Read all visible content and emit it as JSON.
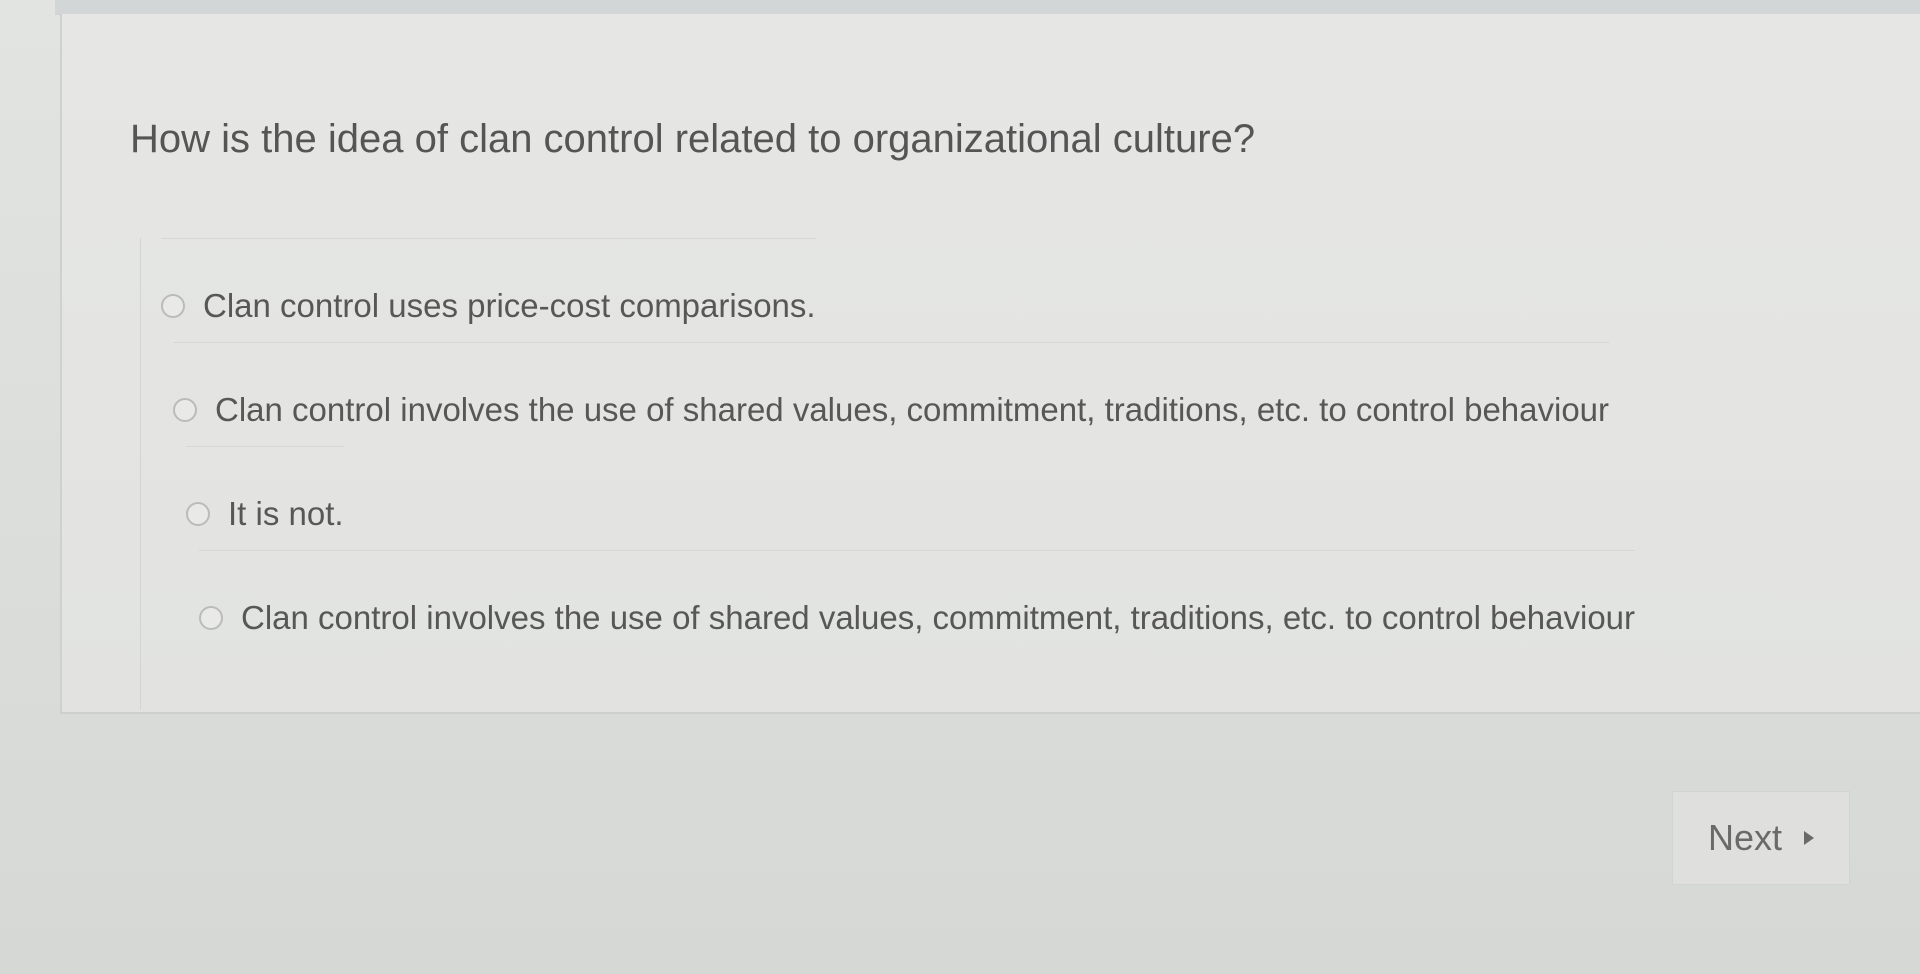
{
  "question": {
    "text": "How is the idea of clan control related to organizational culture?"
  },
  "options": [
    {
      "label": "Clan control uses price-cost comparisons."
    },
    {
      "label": "Clan control involves the use of shared values, commitment, traditions, etc. to control behaviour"
    },
    {
      "label": "It is not."
    },
    {
      "label": "Clan control involves the use of shared values, commitment, traditions, etc. to control behaviour"
    }
  ],
  "navigation": {
    "next_label": "Next",
    "next_icon": "triangle-right-icon"
  }
}
